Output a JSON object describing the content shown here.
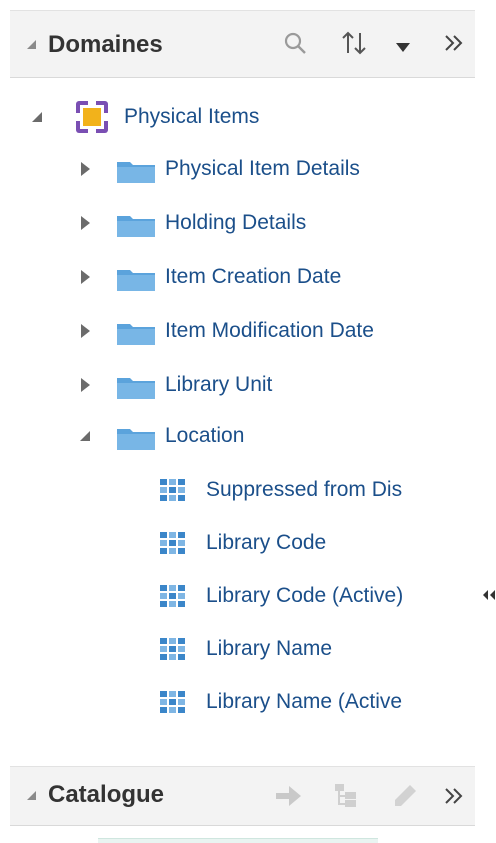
{
  "domaines": {
    "title": "Domaines",
    "icons": [
      "search-icon",
      "sort-icon",
      "chevron-down-icon",
      "expand-panel-icon"
    ]
  },
  "tree": {
    "root": {
      "label": "Physical Items",
      "icon": "subject-area-icon",
      "expanded": true
    },
    "folders": [
      {
        "label": "Physical Item Details",
        "expanded": false
      },
      {
        "label": "Holding Details",
        "expanded": false
      },
      {
        "label": "Item Creation Date",
        "expanded": false
      },
      {
        "label": "Item Modification Date",
        "expanded": false
      },
      {
        "label": "Library Unit",
        "expanded": false
      },
      {
        "label": "Location",
        "expanded": true
      }
    ],
    "columns": [
      {
        "label": "Suppressed from Dis"
      },
      {
        "label": "Library Code"
      },
      {
        "label": "Library Code (Active)"
      },
      {
        "label": "Library Name"
      },
      {
        "label": "Library Name (Active"
      }
    ]
  },
  "catalogue": {
    "title": "Catalogue",
    "icons": [
      "arrow-right-icon",
      "catalog-tree-icon",
      "edit-pencil-icon",
      "expand-panel-icon"
    ]
  },
  "colors": {
    "link_text": "#1b4f8a",
    "folder": "#5ba3dc",
    "header_bg": "#f3f3f3",
    "column_icon": "#3b86c9"
  }
}
